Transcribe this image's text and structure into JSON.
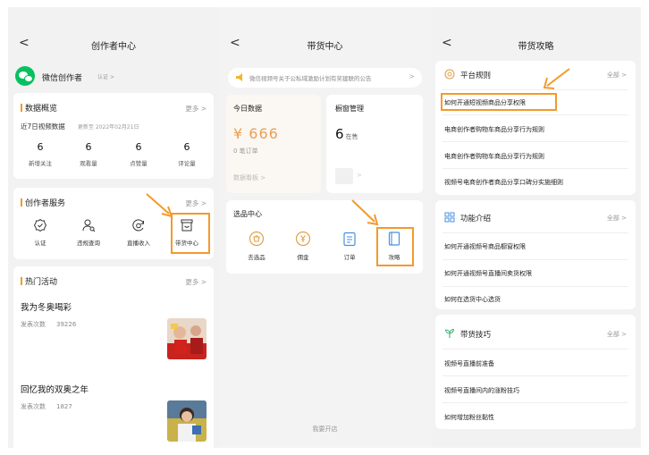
{
  "panel1": {
    "title": "创作者中心",
    "back_glyph": "<",
    "account_name": "微信创作者",
    "account_badge": "认证 >",
    "overview": {
      "title": "数据概览",
      "more": "更多 >",
      "period": "近7日视频数据",
      "updated": "更新至 2022年02月21日",
      "stats": [
        {
          "value": "6",
          "label": "新增关注"
        },
        {
          "value": "6",
          "label": "观看量"
        },
        {
          "value": "6",
          "label": "点赞量"
        },
        {
          "value": "6",
          "label": "评论量"
        }
      ]
    },
    "services": {
      "title": "创作者服务",
      "more": "更多 >",
      "items": [
        {
          "label": "认证",
          "icon": "verified-badge-icon"
        },
        {
          "label": "违规查询",
          "icon": "person-search-icon"
        },
        {
          "label": "直播收入",
          "icon": "coin-cycle-icon"
        },
        {
          "label": "带货中心",
          "icon": "storefront-icon"
        }
      ]
    },
    "hot": {
      "title": "热门活动",
      "more": "更多 >",
      "items": [
        {
          "name": "我为冬奥喝彩",
          "sub_label": "发表次数",
          "count": "39226"
        },
        {
          "name": "回忆我的双奥之年",
          "sub_label": "发表次数",
          "count": "1827"
        }
      ]
    }
  },
  "panel2": {
    "title": "带货中心",
    "back_glyph": "<",
    "notice": "微信视频号关于公私域激励计划有奖建联的公告",
    "notice_chevron": ">",
    "today": {
      "title": "今日数据",
      "amount": "¥ 666",
      "orders": "0 笔订单",
      "link": "数据看板 >"
    },
    "window": {
      "title": "橱窗管理",
      "count": "6",
      "count_suffix": "在售",
      "chevron": ">"
    },
    "tools": {
      "title": "选品中心",
      "items": [
        {
          "label": "去选品",
          "icon": "select-product-icon"
        },
        {
          "label": "佣金",
          "icon": "commission-coin-icon"
        },
        {
          "label": "订单",
          "icon": "order-list-icon"
        },
        {
          "label": "攻略",
          "icon": "guide-book-icon"
        }
      ]
    },
    "bottom": "我要开店"
  },
  "panel3": {
    "title": "带货攻略",
    "back_glyph": "<",
    "sections": [
      {
        "title": "平台规则",
        "all": "全部 >",
        "icon": "rules-circle-icon",
        "items": [
          "如何开通短视频商品分享权限",
          "电商创作者购物车商品分享行为规则",
          "电商创作者购物车商品分享行为规则",
          "视频号电商创作者商品分享口碑分实施细则"
        ]
      },
      {
        "title": "功能介绍",
        "all": "全部 >",
        "icon": "grid-icon",
        "items": [
          "如何开通视频号商品橱窗权限",
          "如何开通视频号直播间卖货权限",
          "如何在选货中心选货"
        ]
      },
      {
        "title": "带货技巧",
        "all": "全部 >",
        "icon": "sprout-icon",
        "items": [
          "视频号直播前准备",
          "视频号直播间内的涨粉技巧",
          "如何增加粉丝黏性"
        ]
      }
    ]
  },
  "colors": {
    "accent": "#f39a2a",
    "amount": "#e8a054",
    "wechat_green": "#07c160",
    "panel_bg": "#f2f2f2"
  }
}
